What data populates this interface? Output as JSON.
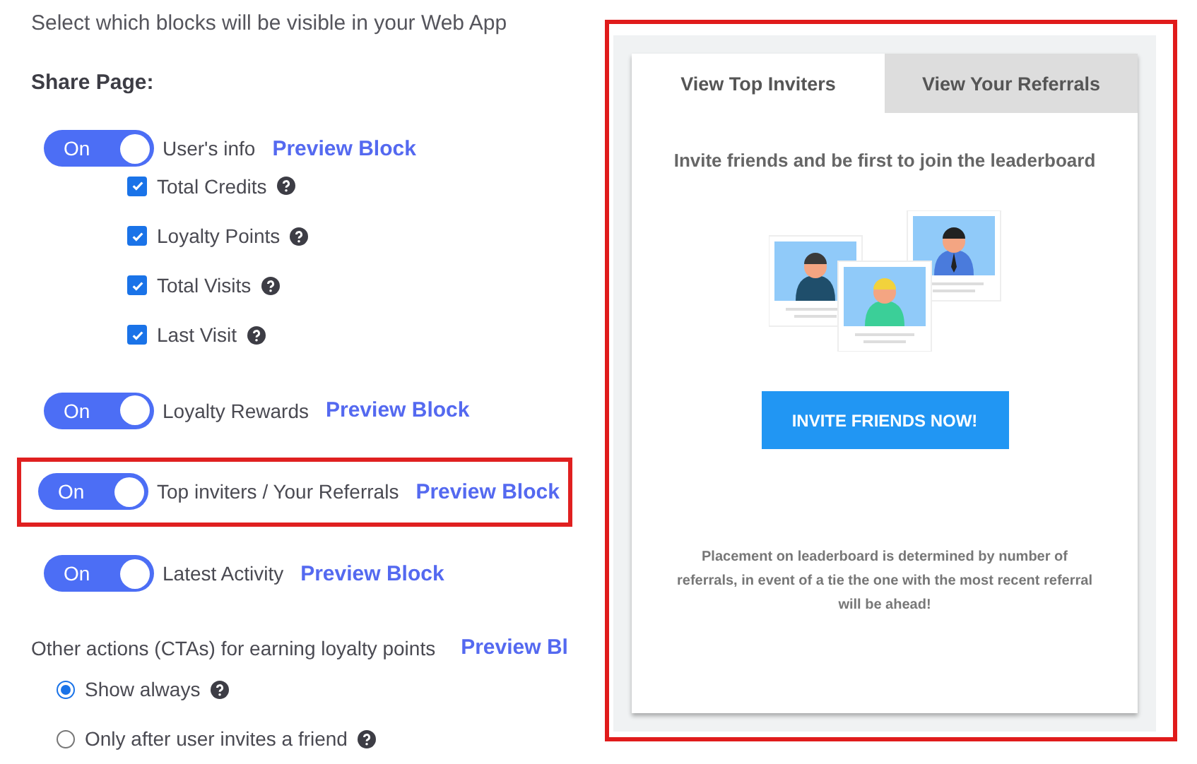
{
  "subtitle": "Select which blocks will be visible in your Web App",
  "section_title": "Share Page:",
  "blocks": [
    {
      "toggle_label": "On",
      "on": true,
      "label": "User's info",
      "preview_link": "Preview Block",
      "highlighted": false,
      "options": [
        {
          "label": "Total Credits",
          "checked": true
        },
        {
          "label": "Loyalty Points",
          "checked": true
        },
        {
          "label": "Total Visits",
          "checked": true
        },
        {
          "label": "Last Visit",
          "checked": true
        }
      ]
    },
    {
      "toggle_label": "On",
      "on": true,
      "label": "Loyalty Rewards",
      "preview_link": "Preview Block",
      "highlighted": false
    },
    {
      "toggle_label": "On",
      "on": true,
      "label": "Top inviters / Your Referrals",
      "preview_link": "Preview Block",
      "highlighted": true
    },
    {
      "toggle_label": "On",
      "on": true,
      "label": "Latest Activity",
      "preview_link": "Preview Block",
      "highlighted": false
    }
  ],
  "ctas": {
    "label": "Other actions (CTAs) for earning loyalty points",
    "preview_link": "Preview Bl",
    "options": [
      {
        "label": "Show always",
        "selected": true
      },
      {
        "label": "Only after user invites a friend",
        "selected": false
      }
    ]
  },
  "preview": {
    "highlighted": true,
    "tabs": [
      {
        "label": "View Top Inviters",
        "selected": true
      },
      {
        "label": "View Your Referrals",
        "selected": false
      }
    ],
    "heading": "Invite friends and be first to join the leaderboard",
    "button": "INVITE FRIENDS NOW!",
    "note": "Placement on leaderboard is determined by number of referrals, in event of a tie the one with the most recent referral will be ahead!"
  }
}
